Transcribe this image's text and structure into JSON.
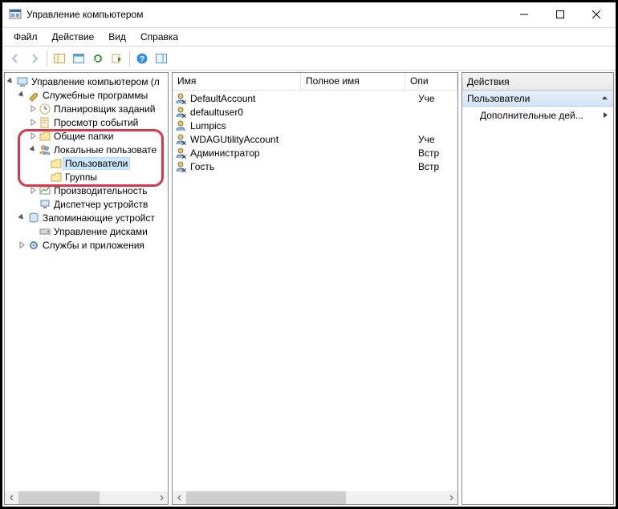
{
  "title": "Управление компьютером",
  "menu": {
    "file": "Файл",
    "action": "Действие",
    "view": "Вид",
    "help": "Справка"
  },
  "tree": {
    "root": "Управление компьютером (л",
    "sys_tools": "Служебные программы",
    "scheduler": "Планировщик заданий",
    "eventviewer": "Просмотр событий",
    "shared": "Общие папки",
    "local_users": "Локальные пользовате",
    "users": "Пользователи",
    "groups": "Группы",
    "perf": "Производительность",
    "devmgr": "Диспетчер устройств",
    "storage": "Запоминающие устройст",
    "diskmgmt": "Управление дисками",
    "services": "Службы и приложения"
  },
  "list": {
    "col_name": "Имя",
    "col_fullname": "Полное имя",
    "col_desc": "Опи",
    "rows": {
      "r0": {
        "name": "DefaultAccount",
        "full": "",
        "desc": "Уче"
      },
      "r1": {
        "name": "defaultuser0",
        "full": "",
        "desc": ""
      },
      "r2": {
        "name": "Lumpics",
        "full": "",
        "desc": ""
      },
      "r3": {
        "name": "WDAGUtilityAccount",
        "full": "",
        "desc": "Уче"
      },
      "r4": {
        "name": "Администратор",
        "full": "",
        "desc": "Встр"
      },
      "r5": {
        "name": "Гость",
        "full": "",
        "desc": "Встр"
      }
    }
  },
  "actions": {
    "header": "Действия",
    "section": "Пользователи",
    "item_more": "Дополнительные дей..."
  }
}
